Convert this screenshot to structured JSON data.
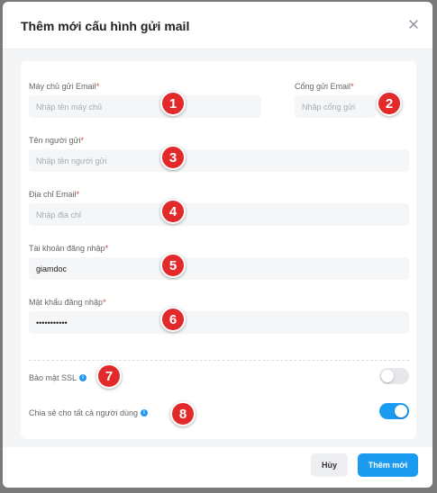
{
  "modal": {
    "title": "Thêm mới cấu hình gửi mail"
  },
  "form": {
    "server": {
      "label": "Máy chủ gửi Email",
      "required": "*",
      "placeholder": "Nhập tên máy chủ",
      "value": ""
    },
    "port": {
      "label": "Cổng gửi Email",
      "required": "*",
      "placeholder": "Nhập cổng gửi",
      "value": ""
    },
    "sender_name": {
      "label": "Tên người gửi",
      "required": "*",
      "placeholder": "Nhập tên người gửi",
      "value": ""
    },
    "email": {
      "label": "Địa chỉ Email",
      "required": "*",
      "placeholder": "Nhập địa chỉ",
      "value": ""
    },
    "username": {
      "label": "Tài khoản đăng nhập",
      "required": "*",
      "placeholder": "",
      "value": "giamdoc"
    },
    "password": {
      "label": "Mật khẩu đăng nhập",
      "required": "*",
      "placeholder": "",
      "value": "•••••••••••"
    },
    "ssl": {
      "label": "Bảo mật SSL",
      "info": "i",
      "enabled": false
    },
    "share": {
      "label": "Chia sẻ cho tất cả người dùng",
      "info": "i",
      "enabled": true
    }
  },
  "markers": [
    "1",
    "2",
    "3",
    "4",
    "5",
    "6",
    "7",
    "8"
  ],
  "buttons": {
    "cancel": "Hủy",
    "save": "Thêm mới"
  },
  "colors": {
    "accent": "#1a9bf0",
    "marker": "#e32a2a",
    "required": "#e53935"
  }
}
